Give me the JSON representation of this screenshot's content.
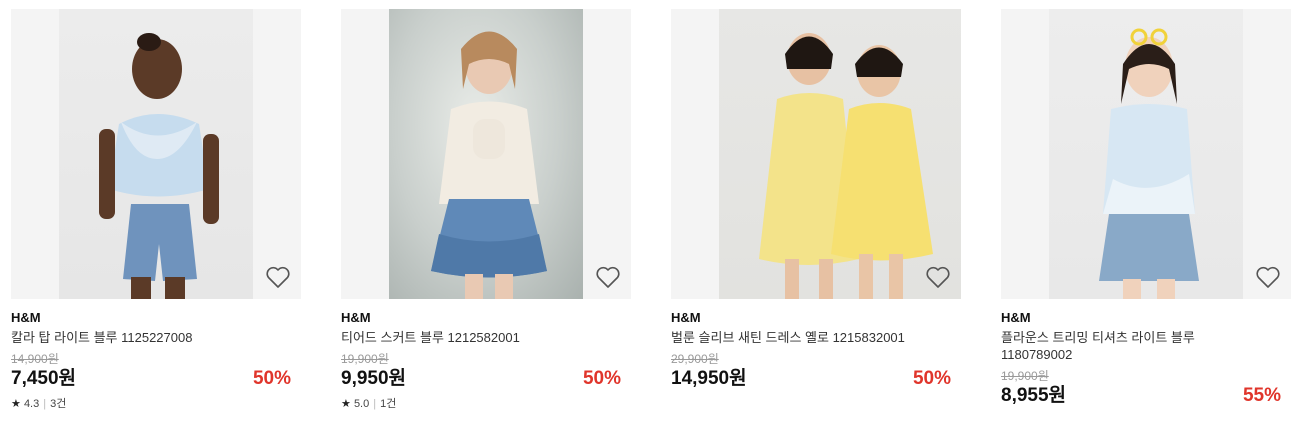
{
  "products": [
    {
      "brand": "H&M",
      "name": "칼라 탑 라이트 블루 1125227008",
      "original_price": "14,900원",
      "price": "7,450원",
      "discount": "50%",
      "rating": "4.3",
      "review_count": "3건",
      "icon": "heart-outline-icon"
    },
    {
      "brand": "H&M",
      "name": "티어드 스커트 블루 1212582001",
      "original_price": "19,900원",
      "price": "9,950원",
      "discount": "50%",
      "rating": "5.0",
      "review_count": "1건",
      "icon": "heart-outline-icon"
    },
    {
      "brand": "H&M",
      "name": "벌룬 슬리브 새틴 드레스 옐로 1215832001",
      "original_price": "29,900원",
      "price": "14,950원",
      "discount": "50%",
      "icon": "heart-outline-icon"
    },
    {
      "brand": "H&M",
      "name": "플라운스 트리밍 티셔츠 라이트 블루 1180789002",
      "original_price": "19,900원",
      "price": "8,955원",
      "discount": "55%",
      "icon": "heart-outline-icon"
    }
  ],
  "colors": {
    "discount": "#e0352b",
    "original_price": "#9a9a9a",
    "thumb_bg": "#f4f4f4"
  }
}
